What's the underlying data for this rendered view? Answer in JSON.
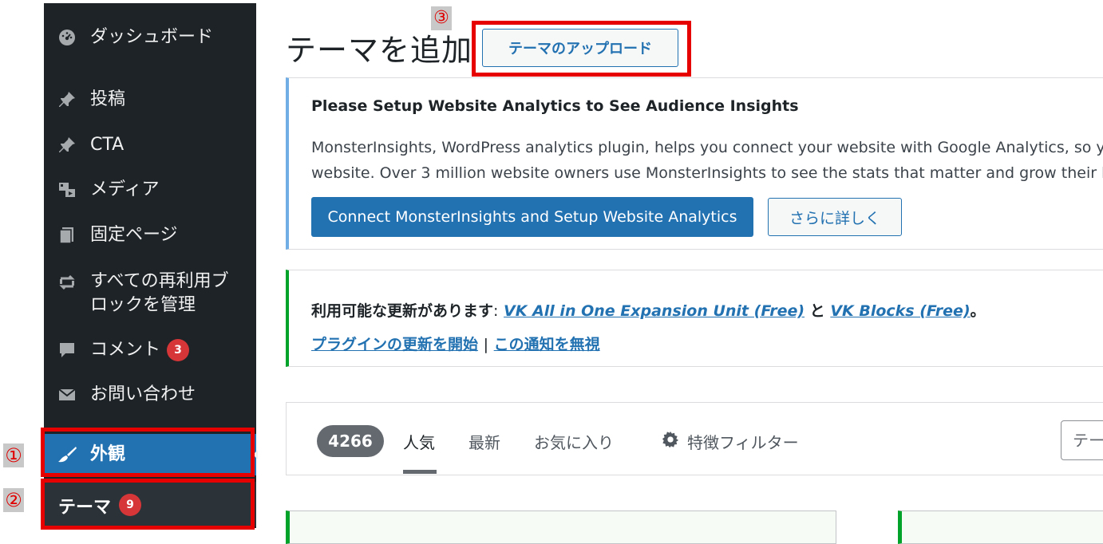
{
  "annotations": {
    "m1": "①",
    "m2": "②",
    "m3": "③"
  },
  "sidebar": {
    "items": [
      {
        "label": "ダッシュボード",
        "icon": "dashboard-icon"
      },
      {
        "label": "投稿",
        "icon": "pin-icon"
      },
      {
        "label": "CTA",
        "icon": "pin-icon"
      },
      {
        "label": "メディア",
        "icon": "media-icon"
      },
      {
        "label": "固定ページ",
        "icon": "page-icon"
      },
      {
        "label": "すべての再利用ブロックを管理",
        "line1": "すべての再利用ブ",
        "line2": "ロックを管理",
        "icon": "reuse-icon"
      },
      {
        "label": "コメント",
        "badge": "3",
        "icon": "comment-icon"
      },
      {
        "label": "お問い合わせ",
        "icon": "mail-icon"
      },
      {
        "label": "外観",
        "icon": "appearance-brush-icon",
        "active": true
      }
    ],
    "submenu": {
      "label": "テーマ",
      "badge": "9"
    }
  },
  "header": {
    "title": "テーマを追加",
    "upload_button": "テーマのアップロード"
  },
  "monsterinsights_notice": {
    "heading": "Please Setup Website Analytics to See Audience Insights",
    "text_line1": "MonsterInsights, WordPress analytics plugin, helps you connect your website with Google Analytics, so y",
    "text_line2": "website. Over 3 million website owners use MonsterInsights to see the stats that matter and grow their b",
    "connect_button": "Connect MonsterInsights and Setup Website Analytics",
    "more_button": "さらに詳しく"
  },
  "update_notice": {
    "prefix": "利用可能な更新があります",
    "colon": ":",
    "plugin1": "VK All in One Expansion Unit (Free)",
    "and": "と",
    "plugin2": "VK Blocks (Free)",
    "period": "。",
    "start_link": "プラグインの更新を開始",
    "separator": "|",
    "dismiss_link": "この通知を無視"
  },
  "filter_bar": {
    "count": "4266",
    "tabs": [
      "人気",
      "最新",
      "お気に入り",
      "特徴フィルター"
    ],
    "search_placeholder": "テー"
  },
  "colors": {
    "sidebar_bg": "#1d2327",
    "active": "#2271b1",
    "badge": "#d63638",
    "annotation": "#e60000"
  }
}
